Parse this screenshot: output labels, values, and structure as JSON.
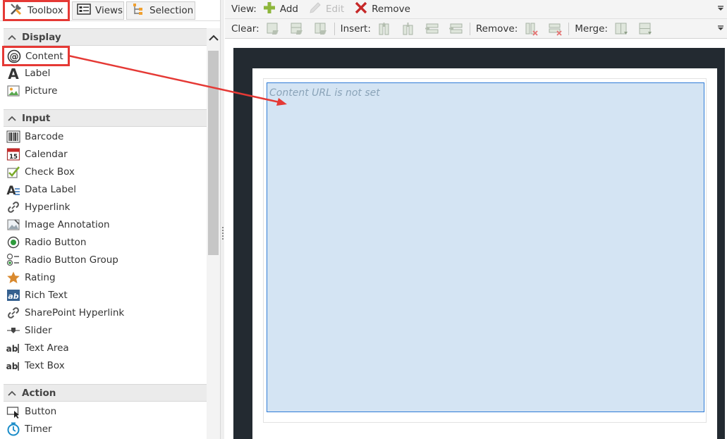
{
  "tabs": [
    {
      "label": "Toolbox",
      "icon": "toolbox-icon",
      "active": true
    },
    {
      "label": "Views",
      "icon": "views-icon",
      "active": false
    },
    {
      "label": "Selection",
      "icon": "selection-icon",
      "active": false
    }
  ],
  "sections": {
    "display": {
      "title": "Display",
      "items": [
        {
          "label": "Content",
          "icon": "content-at-icon"
        },
        {
          "label": "Label",
          "icon": "label-a-icon"
        },
        {
          "label": "Picture",
          "icon": "picture-icon"
        }
      ]
    },
    "input": {
      "title": "Input",
      "items": [
        {
          "label": "Barcode",
          "icon": "barcode-icon"
        },
        {
          "label": "Calendar",
          "icon": "calendar-icon"
        },
        {
          "label": "Check Box",
          "icon": "check-box-icon"
        },
        {
          "label": "Data Label",
          "icon": "data-label-icon"
        },
        {
          "label": "Hyperlink",
          "icon": "hyperlink-icon"
        },
        {
          "label": "Image Annotation",
          "icon": "image-annotation-icon"
        },
        {
          "label": "Radio Button",
          "icon": "radio-button-icon"
        },
        {
          "label": "Radio Button Group",
          "icon": "radio-button-group-icon"
        },
        {
          "label": "Rating",
          "icon": "rating-star-icon"
        },
        {
          "label": "Rich Text",
          "icon": "rich-text-icon"
        },
        {
          "label": "SharePoint Hyperlink",
          "icon": "sharepoint-hyperlink-icon"
        },
        {
          "label": "Slider",
          "icon": "slider-icon"
        },
        {
          "label": "Text Area",
          "icon": "text-area-icon"
        },
        {
          "label": "Text Box",
          "icon": "text-box-icon"
        }
      ]
    },
    "action": {
      "title": "Action",
      "items": [
        {
          "label": "Button",
          "icon": "button-icon"
        },
        {
          "label": "Timer",
          "icon": "timer-icon"
        }
      ]
    }
  },
  "toolbar": {
    "view_label": "View:",
    "add_label": "Add",
    "edit_label": "Edit",
    "remove_label": "Remove",
    "clear_label": "Clear:",
    "insert_label": "Insert:",
    "remove2_label": "Remove:",
    "merge_label": "Merge:"
  },
  "canvas": {
    "placeholder": "Content URL is not set"
  },
  "colors": {
    "highlight_red": "#e53935",
    "control_fill": "#d4e4f3",
    "control_border": "#2f7bd6",
    "frame_dark": "#232a31"
  }
}
